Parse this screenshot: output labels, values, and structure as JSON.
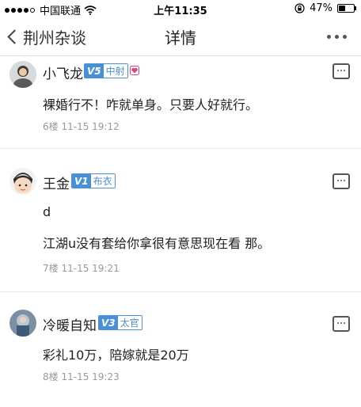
{
  "status_bar": {
    "carrier": "中国联通",
    "time": "上午11:35",
    "battery_text": "47%",
    "battery_level": 0.47
  },
  "nav": {
    "back_label": "荆州杂谈",
    "title": "详情"
  },
  "comments": [
    {
      "username": "小飞龙",
      "badge_level": "V5",
      "badge_title": "中射",
      "lines": [
        "裸婚行不！咋就单身。只要人好就行。"
      ],
      "floor": "6楼",
      "timestamp": "11-15 19:12"
    },
    {
      "username": "王金",
      "badge_level": "V1",
      "badge_title": "布衣",
      "lines": [
        "d",
        "江湖u没有套给你拿很有意思现在看 那。"
      ],
      "floor": "7楼",
      "timestamp": "11-15 19:21"
    },
    {
      "username": "冷暖自知",
      "badge_level": "V3",
      "badge_title": "太官",
      "lines": [
        "彩礼10万，陪嫁就是20万"
      ],
      "floor": "8楼",
      "timestamp": "11-15 19:23"
    }
  ],
  "colors": {
    "badge_blue": "#4a90d9",
    "heart_pink": "#e0457b",
    "meta_gray": "#999999"
  }
}
